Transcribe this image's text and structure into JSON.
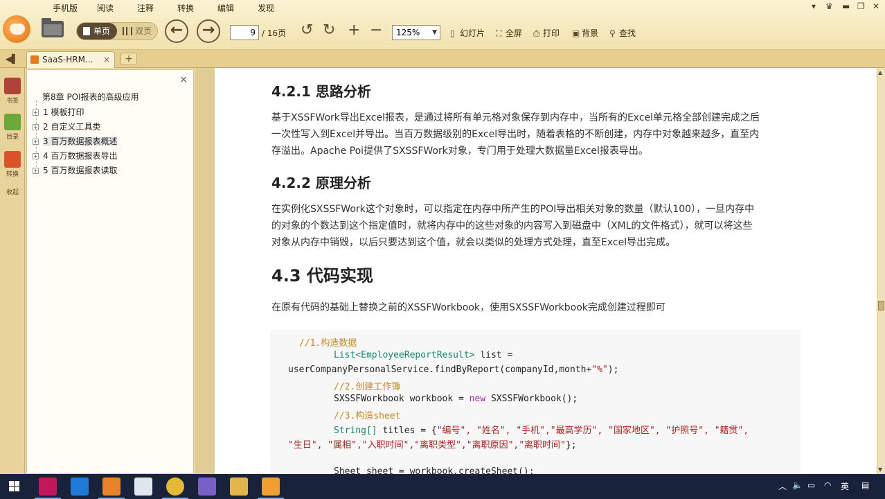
{
  "menu": [
    "手机版",
    "阅读",
    "注释",
    "转换",
    "编辑",
    "发现"
  ],
  "toolbar": {
    "single_page": "单页",
    "double_page": "双页",
    "current_page": "9",
    "total_pages": "/ 16页",
    "zoom": "125%",
    "slideshow": "幻灯片",
    "fullscreen": "全屏",
    "print": "打印",
    "background": "背景",
    "find": "查找"
  },
  "tab": {
    "title": "SaaS-HRM...",
    "close": "×",
    "add": "+"
  },
  "rail": [
    {
      "label": "书签",
      "icon": "bookmark-icon",
      "color": "#b0423a"
    },
    {
      "label": "目录",
      "icon": "toc-icon",
      "color": "#6aa83a"
    },
    {
      "label": "转换",
      "icon": "convert-icon",
      "color": "#d9542b"
    },
    {
      "label": "收起",
      "icon": "collapse-icon",
      "color": "#8a7a5a"
    }
  ],
  "outline": {
    "close": "×",
    "root": "第8章 POI报表的高级应用",
    "items": [
      {
        "label": "1 模板打印"
      },
      {
        "label": "2 自定义工具类"
      },
      {
        "label": "3 百万数据报表概述"
      },
      {
        "label": "4 百万数据报表导出"
      },
      {
        "label": "5 百万数据报表读取"
      }
    ]
  },
  "document": {
    "h_421": "4.2.1 思路分析",
    "p1_l1": "基于XSSFWork导出Excel报表，是通过将所有单元格对象保存到内存中，当所有的Excel单元格全部创建完成之后",
    "p1_l2": "一次性写入到Excel并导出。当百万数据级别的Excel导出时，随着表格的不断创建，内存中对象越来越多，直至内",
    "p1_l3": "存溢出。Apache Poi提供了SXSSFWork对象，专门用于处理大数据量Excel报表导出。",
    "h_422": "4.2.2 原理分析",
    "p2_l1": "在实例化SXSSFWork这个对象时，可以指定在内存中所产生的POI导出相关对象的数量（默认100），一旦内存中",
    "p2_l2": "的对象的个数达到这个指定值时，就将内存中的这些对象的内容写入到磁盘中（XML的文件格式），就可以将这些",
    "p2_l3": "对象从内存中销毁，以后只要达到这个值，就会以类似的处理方式处理，直至Excel导出完成。",
    "h_43": "4.3 代码实现",
    "p3": "在原有代码的基础上替换之前的XSSFWorkbook，使用SXSSFWorkbook完成创建过程即可",
    "code": {
      "c1": "//1.构造数据",
      "l2a": "List<EmployeeReportResult>",
      "l2b": " list =",
      "l3a": "userCompanyPersonalService.findByReport(companyId,month+",
      "l3b": "\"%\"",
      "l3c": ");",
      "c2": "//2.创建工作簿",
      "l5a": "SXSSFWorkbook workbook = ",
      "l5b": "new",
      "l5c": " SXSSFWorkbook();",
      "c3": "//3.构造sheet",
      "l7a": "String[]",
      "l7b": " titles = {",
      "l7c": "\"编号\", \"姓名\", \"手机\",\"最高学历\", \"国家地区\", \"护照号\", \"籍贯\",",
      "l8a": "\"生日\", \"属相\",\"入职时间\",\"离职类型\",\"离职原因\",\"离职时间\"",
      "l8b": "};",
      "l10": "Sheet sheet = workbook.createSheet();"
    }
  },
  "taskbar": {
    "apps": [
      "start-icon",
      "intellij-icon",
      "vscode-icon",
      "foxit-icon",
      "window-icon",
      "chrome-icon",
      "visual-studio-icon",
      "explorer-icon",
      "reader-icon"
    ],
    "tray_lang": "英"
  }
}
